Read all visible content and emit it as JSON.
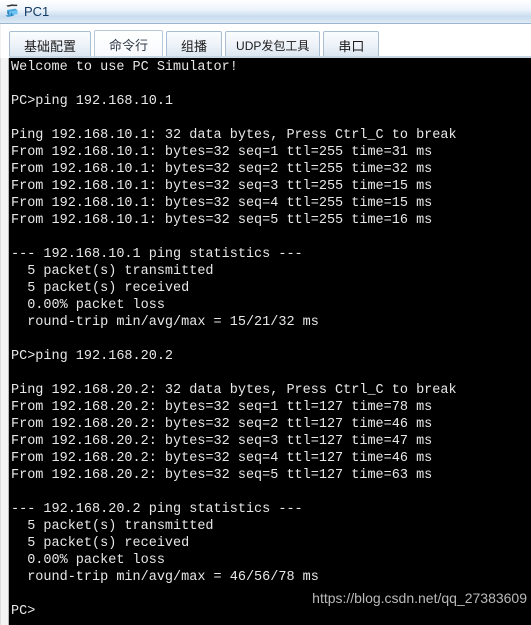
{
  "window": {
    "title": "PC1",
    "icon": "pc-workstation-icon"
  },
  "tabs": [
    {
      "label": "基础配置",
      "selected": false,
      "name": "tab-basic-config"
    },
    {
      "label": "命令行",
      "selected": true,
      "name": "tab-command-line"
    },
    {
      "label": "组播",
      "selected": false,
      "name": "tab-multicast"
    },
    {
      "label": "UDP发包工具",
      "selected": false,
      "name": "tab-udp-tool"
    },
    {
      "label": "串口",
      "selected": false,
      "name": "tab-serial-port"
    }
  ],
  "terminal": {
    "prompt": "PC>",
    "lines": [
      "Welcome to use PC Simulator!",
      "",
      "PC>ping 192.168.10.1",
      "",
      "Ping 192.168.10.1: 32 data bytes, Press Ctrl_C to break",
      "From 192.168.10.1: bytes=32 seq=1 ttl=255 time=31 ms",
      "From 192.168.10.1: bytes=32 seq=2 ttl=255 time=32 ms",
      "From 192.168.10.1: bytes=32 seq=3 ttl=255 time=15 ms",
      "From 192.168.10.1: bytes=32 seq=4 ttl=255 time=15 ms",
      "From 192.168.10.1: bytes=32 seq=5 ttl=255 time=16 ms",
      "",
      "--- 192.168.10.1 ping statistics ---",
      "  5 packet(s) transmitted",
      "  5 packet(s) received",
      "  0.00% packet loss",
      "  round-trip min/avg/max = 15/21/32 ms",
      "",
      "PC>ping 192.168.20.2",
      "",
      "Ping 192.168.20.2: 32 data bytes, Press Ctrl_C to break",
      "From 192.168.20.2: bytes=32 seq=1 ttl=127 time=78 ms",
      "From 192.168.20.2: bytes=32 seq=2 ttl=127 time=46 ms",
      "From 192.168.20.2: bytes=32 seq=3 ttl=127 time=47 ms",
      "From 192.168.20.2: bytes=32 seq=4 ttl=127 time=46 ms",
      "From 192.168.20.2: bytes=32 seq=5 ttl=127 time=63 ms",
      "",
      "--- 192.168.20.2 ping statistics ---",
      "  5 packet(s) transmitted",
      "  5 packet(s) received",
      "  0.00% packet loss",
      "  round-trip min/avg/max = 46/56/78 ms",
      "",
      "PC>"
    ]
  },
  "watermark": {
    "text": "https://blog.csdn.net/qq_27383609"
  },
  "colors": {
    "terminal_background": "#000000",
    "terminal_text": "#e8e8e8",
    "titlebar_accent": "#c9dcee",
    "title_text": "#123a63",
    "watermark_text": "#c9c9c9"
  }
}
